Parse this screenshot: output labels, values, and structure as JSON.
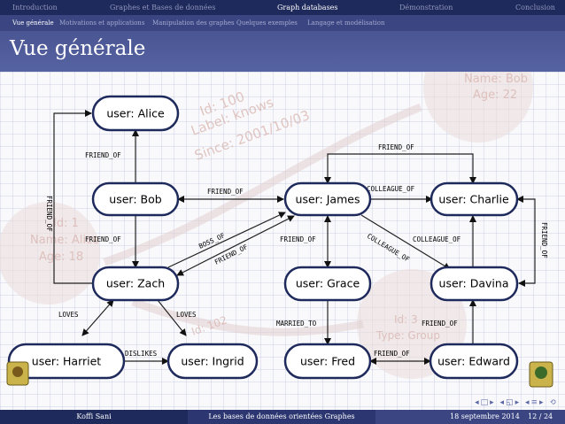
{
  "nav": {
    "sections": [
      "Introduction",
      "Graphes et Bases de données",
      "Graph databases",
      "Démonstration",
      "Conclusion"
    ],
    "active_section": "Graph databases",
    "subsections": [
      "Vue générale",
      "Motivations et applications",
      "Manipulation des graphes",
      "Quelques exemples",
      "Langage et modélisation"
    ],
    "active_subsection": "Vue générale"
  },
  "slide_title": "Vue générale",
  "graph": {
    "nodes": {
      "alice": "user: Alice",
      "bob": "user: Bob",
      "james": "user: James",
      "charlie": "user: Charlie",
      "zach": "user: Zach",
      "grace": "user: Grace",
      "davina": "user: Davina",
      "harriet": "user: Harriet",
      "ingrid": "user: Ingrid",
      "fred": "user: Fred",
      "edward": "user: Edward"
    },
    "edges": [
      {
        "from": "bob",
        "to": "alice",
        "label": "FRIEND_OF"
      },
      {
        "from": "zach",
        "to": "alice",
        "label": "FRIEND_OF"
      },
      {
        "from": "bob",
        "to": "james",
        "label": "FRIEND_OF"
      },
      {
        "from": "bob",
        "to": "zach",
        "label": "FRIEND_OF"
      },
      {
        "from": "zach",
        "to": "james",
        "label": "BOSS_OF"
      },
      {
        "from": "zach",
        "to": "james",
        "label": "FRIEND_OF"
      },
      {
        "from": "james",
        "to": "charlie",
        "label": "COLLEAGUE_OF"
      },
      {
        "from": "james",
        "to": "charlie",
        "label": "FRIEND_OF"
      },
      {
        "from": "grace",
        "to": "james",
        "label": "FRIEND_OF"
      },
      {
        "from": "james",
        "to": "davina",
        "label": "COLLEAGUE_OF"
      },
      {
        "from": "davina",
        "to": "charlie",
        "label": "COLLEAGUE_OF"
      },
      {
        "from": "charlie",
        "to": "davina",
        "label": "FRIEND_OF"
      },
      {
        "from": "zach",
        "to": "harriet",
        "label": "LOVES"
      },
      {
        "from": "zach",
        "to": "ingrid",
        "label": "LOVES"
      },
      {
        "from": "harriet",
        "to": "ingrid",
        "label": "DISLIKES"
      },
      {
        "from": "grace",
        "to": "fred",
        "label": "MARRIED_TO"
      },
      {
        "from": "fred",
        "to": "edward",
        "label": "FRIEND_OF"
      },
      {
        "from": "edward",
        "to": "davina",
        "label": "FRIEND_OF"
      }
    ],
    "background_texts": [
      "Name: Bob",
      "Age: 22",
      "Id: 100",
      "Label: knows",
      "Since: 2001/10/03",
      "Id: 1",
      "Name: Alice",
      "Age: 18",
      "Id: 102",
      "Id: 3",
      "Type: Group"
    ]
  },
  "footer": {
    "author": "Koffi Sani",
    "title": "Les bases de données orientées Graphes",
    "date": "18 septembre 2014",
    "page": "12 / 24"
  },
  "colors": {
    "nav_dark": "#1f2a5c",
    "nav_mid": "#3a4582",
    "title_bar": "#4f5b9b",
    "node_border": "#1f2a5c"
  }
}
